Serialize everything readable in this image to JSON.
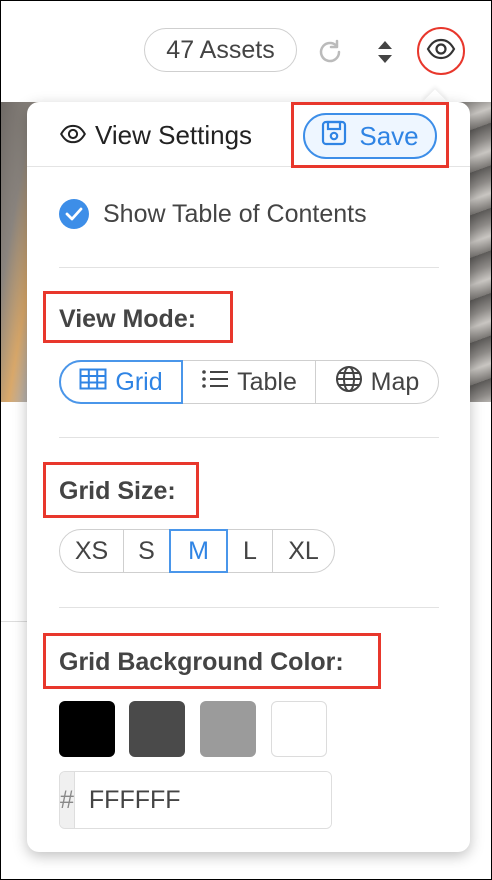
{
  "toolbar": {
    "assets_count": "47 Assets",
    "icons": {
      "refresh": "refresh-icon",
      "sort": "sort-icon",
      "view": "eye-icon"
    }
  },
  "panel": {
    "title": "View Settings",
    "save_label": "Save",
    "show_toc_label": "Show Table of Contents",
    "show_toc_checked": true,
    "view_mode": {
      "title": "View Mode:",
      "options": [
        {
          "label": "Grid",
          "icon": "grid-icon"
        },
        {
          "label": "Table",
          "icon": "list-icon"
        },
        {
          "label": "Map",
          "icon": "globe-icon"
        }
      ],
      "selected": "Grid"
    },
    "grid_size": {
      "title": "Grid Size:",
      "options": [
        "XS",
        "S",
        "M",
        "L",
        "XL"
      ],
      "selected": "M"
    },
    "grid_bg": {
      "title": "Grid Background Color:",
      "swatches": [
        "#000000",
        "#4a4a4a",
        "#9b9b9b",
        "#ffffff"
      ],
      "hex_prefix": "#",
      "hex_value": "FFFFFF"
    }
  },
  "colors": {
    "accent": "#3d8ee8",
    "highlight": "#e8372c"
  }
}
